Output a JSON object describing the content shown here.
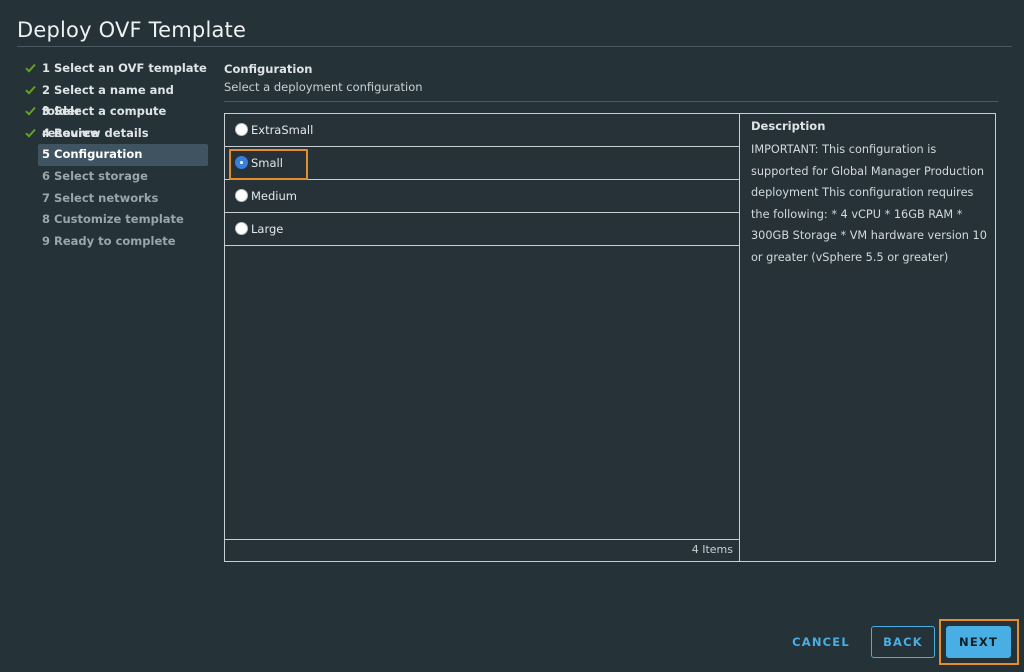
{
  "window": {
    "title": "Deploy OVF Template"
  },
  "steps": [
    {
      "number": "1",
      "label": "Select an OVF template",
      "state": "done"
    },
    {
      "number": "2",
      "label": "Select a name and folder",
      "state": "done"
    },
    {
      "number": "3",
      "label": "Select a compute resource",
      "state": "done"
    },
    {
      "number": "4",
      "label": "Review details",
      "state": "done"
    },
    {
      "number": "5",
      "label": "Configuration",
      "state": "active"
    },
    {
      "number": "6",
      "label": "Select storage",
      "state": "pending"
    },
    {
      "number": "7",
      "label": "Select networks",
      "state": "pending"
    },
    {
      "number": "8",
      "label": "Customize template",
      "state": "pending"
    },
    {
      "number": "9",
      "label": "Ready to complete",
      "state": "pending"
    }
  ],
  "section": {
    "title": "Configuration",
    "subtitle": "Select a deployment configuration"
  },
  "configs": {
    "options": [
      {
        "label": "ExtraSmall",
        "selected": false
      },
      {
        "label": "Small",
        "selected": true
      },
      {
        "label": "Medium",
        "selected": false
      },
      {
        "label": "Large",
        "selected": false
      }
    ],
    "count_label": "4 Items"
  },
  "description": {
    "title": "Description",
    "text": "IMPORTANT: This configuration is supported for Global Manager Production deployment This configuration requires the following: * 4 vCPU * 16GB RAM * 300GB Storage * VM hardware version 10 or greater (vSphere 5.5 or greater)"
  },
  "buttons": {
    "cancel": "CANCEL",
    "back": "BACK",
    "next": "NEXT"
  },
  "colors": {
    "background": "#253238",
    "accent": "#49aee3",
    "radio_selected": "#3a7fd9",
    "check": "#62a420",
    "highlight": "#e38d2b"
  },
  "icons": {
    "step_done": "checkmark-icon"
  }
}
